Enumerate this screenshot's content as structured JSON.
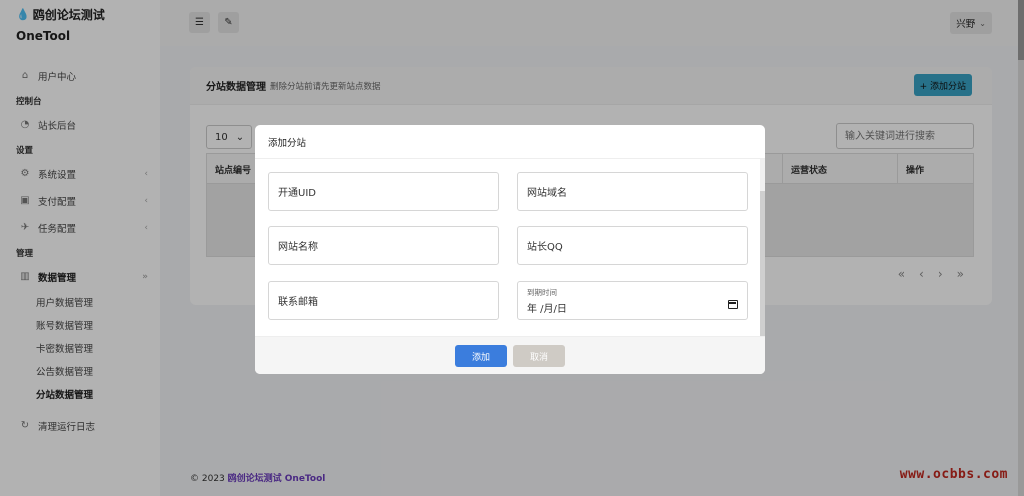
{
  "brand": {
    "name": "鸥创论坛测试",
    "sub": "OneTool",
    "icon": "drop-icon"
  },
  "sidebar": {
    "user_center": "用户中心",
    "section_console": "控制台",
    "admin_backend": "站长后台",
    "section_settings": "设置",
    "system_settings": "系统设置",
    "payment_config": "支付配置",
    "task_config": "任务配置",
    "section_manage": "管理",
    "data_manage": "数据管理",
    "sub_items": [
      "用户数据管理",
      "账号数据管理",
      "卡密数据管理",
      "公告数据管理",
      "分站数据管理"
    ],
    "clear_logs": "清理运行日志"
  },
  "topbar": {
    "user": "兴野"
  },
  "card": {
    "title": "分站数据管理",
    "subtitle": "删除分站前请先更新站点数据",
    "add_button": "+ 添加分站",
    "page_size": "10",
    "search_placeholder": "输入关键词进行搜索",
    "columns": [
      "站点编号",
      "运营状态",
      "操作"
    ]
  },
  "footer": {
    "copyright": "© 2023",
    "link": "鸥创论坛测试 OneTool"
  },
  "watermark": "www.ocbbs.com",
  "modal": {
    "title": "添加分站",
    "fields": {
      "uid": "开通UID",
      "domain": "网站域名",
      "site_name": "网站名称",
      "qq": "站长QQ",
      "email": "联系邮箱",
      "expire_label": "到期时间",
      "expire_value": "年 /月/日"
    },
    "add": "添加",
    "cancel": "取消"
  },
  "colors": {
    "primary": "#3b7ddd",
    "accent": "#38a3c4",
    "brand": "#6a3cbc"
  }
}
